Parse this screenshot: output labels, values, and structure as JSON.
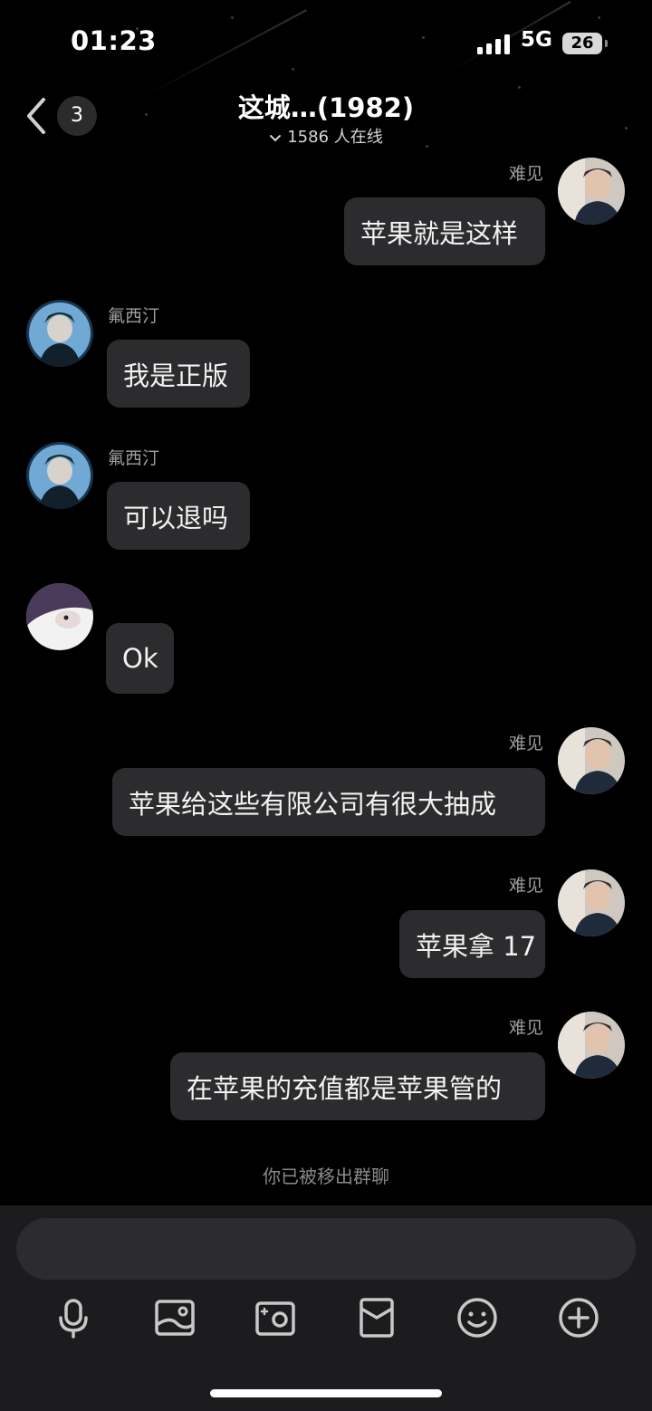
{
  "status_bar": {
    "time": "01:23",
    "network": "5G",
    "battery": "26"
  },
  "header": {
    "unread_count": "3",
    "title": "这城…(1982)",
    "online": "1586 人在线"
  },
  "messages": [
    {
      "sender": "难见",
      "text": "苹果就是这样",
      "side": "right"
    },
    {
      "sender": "氟西汀",
      "text": "我是正版",
      "side": "left"
    },
    {
      "sender": "氟西汀",
      "text": "可以退吗",
      "side": "left"
    },
    {
      "sender": "",
      "text": "Ok",
      "side": "left"
    },
    {
      "sender": "难见",
      "text": "苹果给这些有限公司有很大抽成",
      "side": "right"
    },
    {
      "sender": "难见",
      "text": "苹果拿 17",
      "side": "right"
    },
    {
      "sender": "难见",
      "text": "在苹果的充值都是苹果管的",
      "side": "right"
    }
  ],
  "system_notice": "你已被移出群聊",
  "input": {
    "placeholder": ""
  },
  "toolbar": [
    "microphone-icon",
    "image-icon",
    "camera-icon",
    "red-packet-icon",
    "emoji-icon",
    "plus-icon"
  ],
  "colors": {
    "background": "#000000",
    "bubble": "#2c2c2e",
    "panel": "#1c1c1e",
    "muted_text": "#9e9e9e"
  }
}
